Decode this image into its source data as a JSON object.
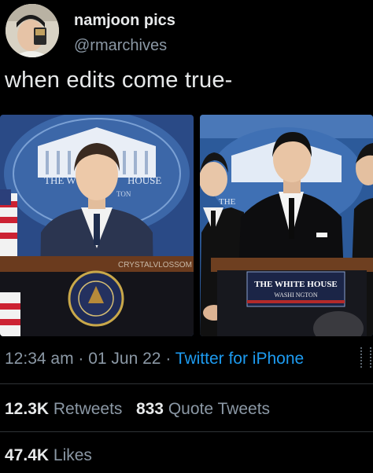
{
  "author": {
    "display_name": "namjoon pics",
    "handle": "@rmarchives"
  },
  "tweet": {
    "text": "when edits come true-"
  },
  "media": {
    "left_watermark": "CRYSTALVLOSSOM",
    "left_backdrop_text_1": "THE W",
    "left_backdrop_text_2": "HOUSE",
    "left_backdrop_text_3": "TON",
    "right_podium_line_1": "THE WHITE HOUSE",
    "right_podium_line_2": "WASHI NGTON",
    "right_backdrop_text": "THE"
  },
  "meta": {
    "time": "12:34 am",
    "sep1": " · ",
    "date": "01 Jun 22",
    "sep2": " · ",
    "source": "Twitter for iPhone"
  },
  "stats": {
    "retweets_count": "12.3K",
    "retweets_label": "Retweets",
    "quotes_count": "833",
    "quotes_label": "Quote Tweets",
    "likes_count": "47.4K",
    "likes_label": "Likes"
  },
  "colors": {
    "link": "#1d9bf0",
    "secondary_text": "#8b98a5",
    "primary_text": "#e7e9ea",
    "background": "#000000"
  }
}
